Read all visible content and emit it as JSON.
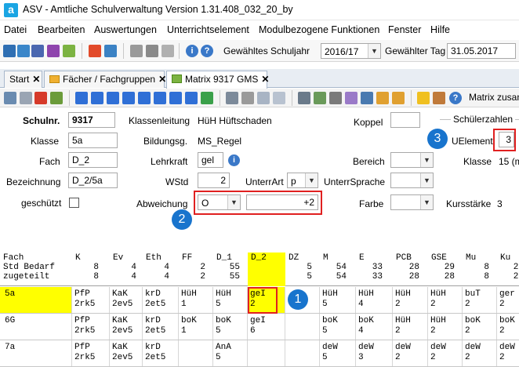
{
  "window": {
    "app_logo": "a",
    "title": "ASV - Amtliche Schulverwaltung Version 1.31.408_032_20_by"
  },
  "menu": [
    "Datei",
    "Bearbeiten",
    "Auswertungen",
    "Unterrichtselement",
    "Modulbezogene Funktionen",
    "Fenster",
    "Hilfe"
  ],
  "toolbar1": {
    "schuljahr_label": "Gewähltes Schuljahr",
    "schuljahr_value": "2016/17",
    "tag_label": "Gewählter Tag",
    "tag_value": "31.05.2017"
  },
  "tabs": [
    {
      "label": "Start",
      "icon": "none"
    },
    {
      "label": "Fächer / Fachgruppen",
      "icon": "folder-icon"
    },
    {
      "label": "Matrix 9317 GMS",
      "icon": "matrix-icon"
    }
  ],
  "toolbar2": {
    "matrix_label": "Matrix zusan"
  },
  "form": {
    "schulnr_label": "Schulnr.",
    "schulnr_value": "9317",
    "klassenleitung_label": "Klassenleitung",
    "klassenleitung_value": "HüH Hüftschaden",
    "koppel_label": "Koppel",
    "koppel_value": "",
    "schuelerzahlen_label": "Schülerzahlen",
    "klasse_label": "Klasse",
    "klasse_value": "5a",
    "bildungsg_label": "Bildungsg.",
    "bildungsg_value": "MS_Regel",
    "uelement_label": "UElement",
    "uelement_value": "3",
    "fach_label": "Fach",
    "fach_value": "D_2",
    "lehrkraft_label": "Lehrkraft",
    "lehrkraft_value": "gel",
    "bereich_label": "Bereich",
    "bereich_value": "",
    "klasse2_label": "Klasse",
    "klasse2_value": "15 (m",
    "bezeichnung_label": "Bezeichnung",
    "bezeichnung_value": "D_2/5a",
    "wstd_label": "WStd",
    "wstd_value": "2",
    "unterrart_label": "UnterrArt",
    "unterrart_value": "p",
    "unterrsprache_label": "UnterrSprache",
    "unterrsprache_value": "",
    "geschuetzt_label": "geschützt",
    "abweichung_label": "Abweichung",
    "abweichung_value": "O",
    "abweichung_amount": "+2",
    "farbe_label": "Farbe",
    "farbe_value": "",
    "kursstaerke_label": "Kursstärke",
    "kursstaerke_value": "3"
  },
  "callouts": [
    "1",
    "2",
    "3"
  ],
  "matrix": {
    "row_headers": [
      "Fach",
      "Std Bedarf",
      "zugeteilt"
    ],
    "columns": [
      {
        "fach": "K",
        "bedarf": "8",
        "zugeteilt": "8"
      },
      {
        "fach": "Ev",
        "bedarf": "4",
        "zugeteilt": "4"
      },
      {
        "fach": "Eth",
        "bedarf": "4",
        "zugeteilt": "4"
      },
      {
        "fach": "FF",
        "bedarf": "2",
        "zugeteilt": "2"
      },
      {
        "fach": "D_1",
        "bedarf": "55",
        "zugeteilt": "55"
      },
      {
        "fach": "D_2",
        "bedarf": "",
        "zugeteilt": ""
      },
      {
        "fach": "DZ",
        "bedarf": "5",
        "zugeteilt": "5"
      },
      {
        "fach": "M",
        "bedarf": "54",
        "zugeteilt": "54"
      },
      {
        "fach": "E",
        "bedarf": "33",
        "zugeteilt": "33"
      },
      {
        "fach": "PCB",
        "bedarf": "28",
        "zugeteilt": "28"
      },
      {
        "fach": "GSE",
        "bedarf": "29",
        "zugeteilt": "28"
      },
      {
        "fach": "Mu",
        "bedarf": "8",
        "zugeteilt": "8"
      },
      {
        "fach": "Ku",
        "bedarf": "20",
        "zugeteilt": "20"
      }
    ],
    "rows": [
      {
        "klasse": "5a",
        "cells": [
          [
            "PfP",
            "2rk5"
          ],
          [
            "KaK",
            "2ev5"
          ],
          [
            "krD",
            "2et5"
          ],
          [
            "HüH",
            "1"
          ],
          [
            "HüH",
            "5"
          ],
          [
            "geI",
            "2"
          ],
          [
            "",
            ""
          ],
          [
            "HüH",
            "5"
          ],
          [
            "HüH",
            "4"
          ],
          [
            "HüH",
            "2"
          ],
          [
            "HüH",
            "2"
          ],
          [
            "buT",
            "2"
          ],
          [
            "ger",
            "2"
          ]
        ]
      },
      {
        "klasse": "6G",
        "cells": [
          [
            "PfP",
            "2rk5"
          ],
          [
            "KaK",
            "2ev5"
          ],
          [
            "krD",
            "2et5"
          ],
          [
            "boK",
            "1"
          ],
          [
            "boK",
            "5"
          ],
          [
            "geI",
            "6"
          ],
          [
            "",
            ""
          ],
          [
            "boK",
            "5"
          ],
          [
            "boK",
            "4"
          ],
          [
            "HüH",
            "2"
          ],
          [
            "HüH",
            "2"
          ],
          [
            "boK",
            "2"
          ],
          [
            "boK",
            "2"
          ]
        ]
      },
      {
        "klasse": "7a",
        "cells": [
          [
            "PfP",
            "2rk5"
          ],
          [
            "KaK",
            "2ev5"
          ],
          [
            "krD",
            "2et5"
          ],
          [
            "",
            ""
          ],
          [
            "AnA",
            "5"
          ],
          [
            "",
            ""
          ],
          [
            "",
            ""
          ],
          [
            "deW",
            "5"
          ],
          [
            "deW",
            "3"
          ],
          [
            "deW",
            "2"
          ],
          [
            "deW",
            "2"
          ],
          [
            "deW",
            "2"
          ],
          [
            "deW",
            "2"
          ]
        ]
      }
    ]
  },
  "colors": {
    "highlight_yellow": "#ffff00",
    "callout_blue": "#1874cd",
    "callout_red": "#e02020"
  }
}
